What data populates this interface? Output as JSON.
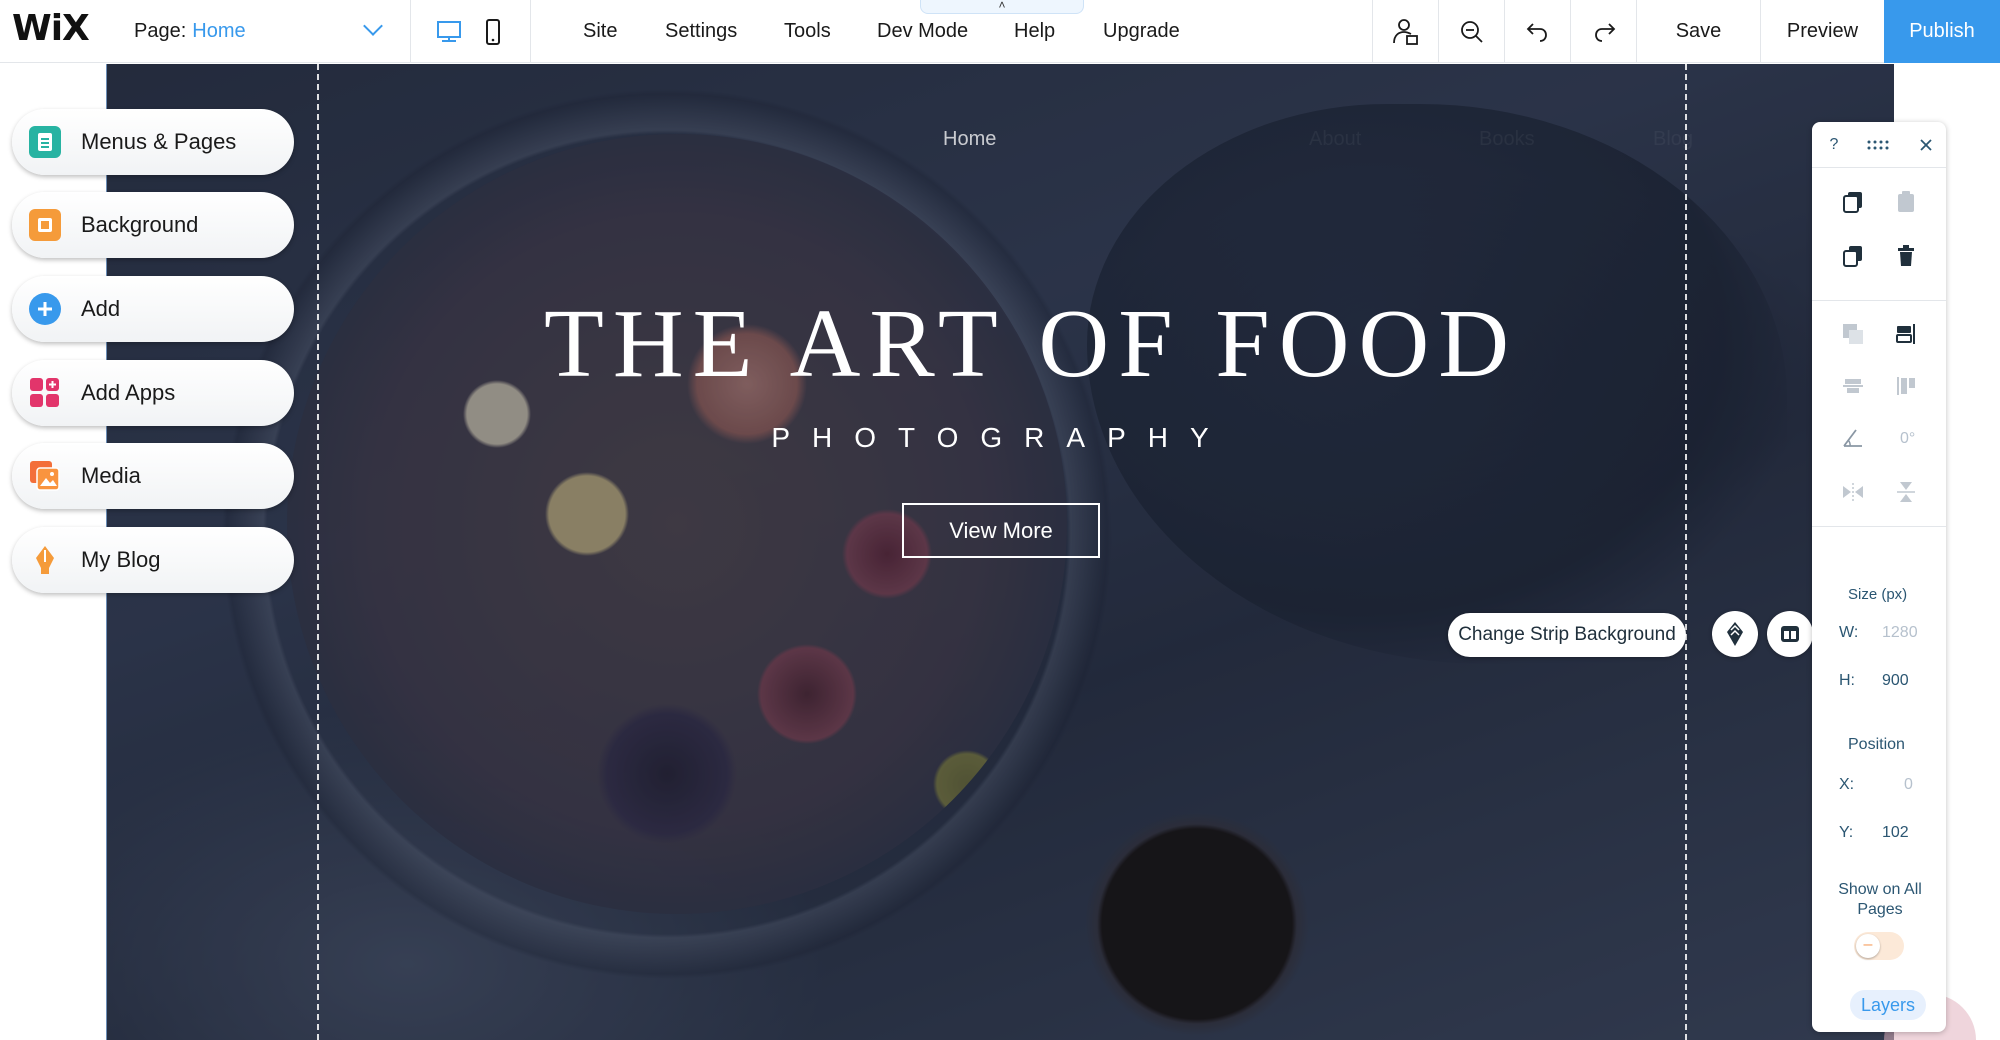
{
  "topbar": {
    "logo": "WiX",
    "page_label": "Page:",
    "page_value": "Home",
    "menu": [
      "Site",
      "Settings",
      "Tools",
      "Dev Mode",
      "Help",
      "Upgrade"
    ],
    "notch_glyph": "˄",
    "save": "Save",
    "preview": "Preview",
    "publish": "Publish"
  },
  "left_panel": {
    "items": [
      {
        "label": "Menus & Pages",
        "icon": "pages-icon"
      },
      {
        "label": "Background",
        "icon": "background-icon"
      },
      {
        "label": "Add",
        "icon": "add-icon"
      },
      {
        "label": "Add Apps",
        "icon": "apps-icon"
      },
      {
        "label": "Media",
        "icon": "media-icon"
      },
      {
        "label": "My Blog",
        "icon": "blog-icon"
      }
    ]
  },
  "site": {
    "nav": [
      "Home",
      "About",
      "Books",
      "Blog"
    ],
    "title": "THE ART OF FOOD",
    "subtitle": "PHOTOGRAPHY",
    "cta": "View More"
  },
  "strip_controls": {
    "change_bg": "Change Strip Background"
  },
  "right_panel": {
    "help": "?",
    "rotation": "0°",
    "size_label": "Size (px)",
    "w_label": "W:",
    "w_value": "1280",
    "h_label": "H:",
    "h_value": "900",
    "position_label": "Position",
    "x_label": "X:",
    "x_value": "0",
    "y_label": "Y:",
    "y_value": "102",
    "show_all_pages": "Show on All Pages",
    "toggle_glyph": "–",
    "show_all_pages_on": false,
    "layers": "Layers"
  },
  "colors": {
    "accent": "#3899ec",
    "strip_bg": "#2e3648"
  }
}
